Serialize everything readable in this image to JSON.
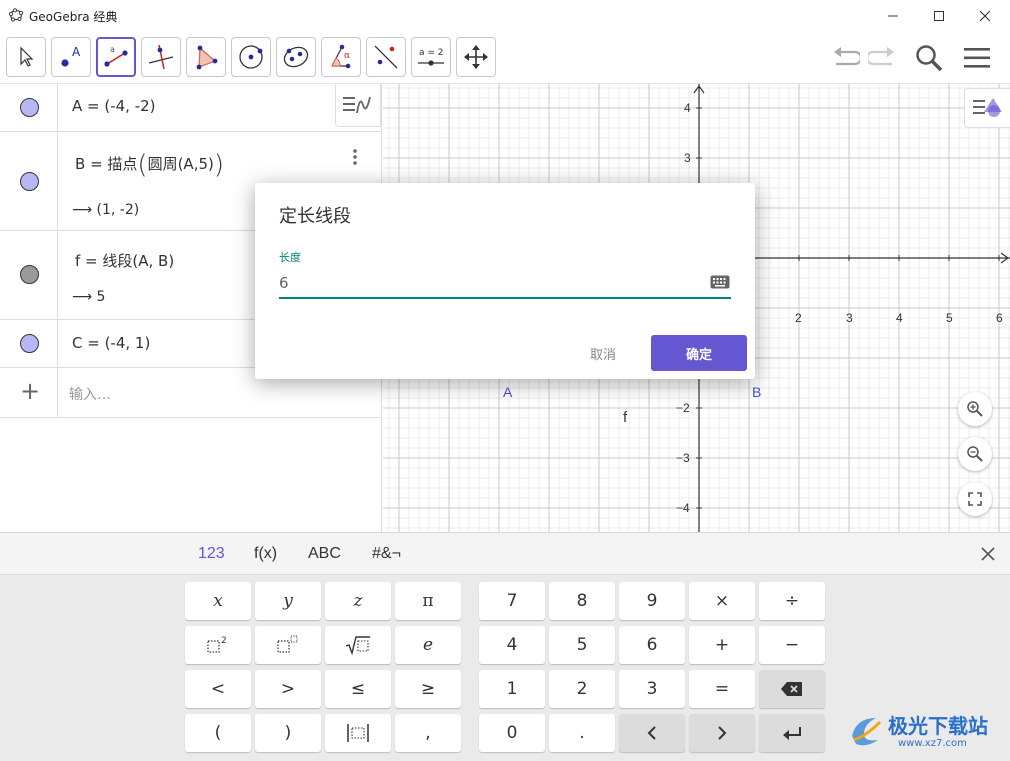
{
  "window": {
    "title": "GeoGebra 经典"
  },
  "toolbar": {
    "tools": [
      {
        "name": "move-tool",
        "icon": "arrow-pointer-icon"
      },
      {
        "name": "point-tool",
        "icon": "point-icon",
        "label": "A"
      },
      {
        "name": "segment-tool",
        "icon": "segment-icon",
        "label": "a",
        "selected": true
      },
      {
        "name": "perpendicular-line-tool",
        "icon": "perpendicular-icon"
      },
      {
        "name": "polygon-tool",
        "icon": "polygon-icon"
      },
      {
        "name": "circle-tool",
        "icon": "circle-icon"
      },
      {
        "name": "ellipse-tool",
        "icon": "ellipse-icon"
      },
      {
        "name": "angle-tool",
        "icon": "angle-icon",
        "label": "α"
      },
      {
        "name": "reflect-tool",
        "icon": "reflect-icon"
      },
      {
        "name": "slider-tool",
        "icon": "slider-icon",
        "label": "a = 2"
      },
      {
        "name": "move-graphics-tool",
        "icon": "move-arrows-icon"
      }
    ]
  },
  "algebra": {
    "rows": [
      {
        "text": "A = (-4, -2)",
        "color": "#b9b6f5"
      },
      {
        "name": "B",
        "cmd": "描点",
        "inner": "圆周(A,5)",
        "result": "⟶ (1, -2)",
        "color": "#b9b6f5"
      },
      {
        "text": "f = 线段(A, B)",
        "result": "⟶ 5",
        "color": "#9a9a9a"
      },
      {
        "text": "C = (-4, 1)",
        "color": "#b9b6f5"
      }
    ],
    "input_placeholder": "输入…",
    "add_symbol": "+"
  },
  "graphics": {
    "x_ticks": [
      "2",
      "3",
      "4",
      "5",
      "6"
    ],
    "y_ticks": [
      "4",
      "3",
      "−2",
      "−3",
      "−4"
    ],
    "point_a_label": "A",
    "point_b_label": "B",
    "segment_label": "f",
    "colors": {
      "point": "#4d4dcc",
      "label": "#4d4dcc"
    }
  },
  "dialog": {
    "title": "定长线段",
    "field_label": "长度",
    "field_value": "6",
    "cancel_label": "取消",
    "ok_label": "确定"
  },
  "keyboard": {
    "tabs": [
      "123",
      "f(x)",
      "ABC",
      "#&¬"
    ],
    "active_tab": "123",
    "left_keys": [
      [
        "x",
        "y",
        "z",
        "π"
      ],
      [
        "□²",
        "□ⁿ",
        "√□",
        "e"
      ],
      [
        "<",
        ">",
        "≤",
        "≥"
      ],
      [
        "(",
        ")",
        "|□|",
        ","
      ]
    ],
    "right_keys": [
      [
        "7",
        "8",
        "9",
        "×",
        "÷"
      ],
      [
        "4",
        "5",
        "6",
        "+",
        "−"
      ],
      [
        "1",
        "2",
        "3",
        "=",
        "⌫"
      ],
      [
        "0",
        ".",
        "<",
        ">",
        "↵"
      ]
    ]
  },
  "watermark": {
    "text": "极光下载站",
    "url": "www.xz7.com"
  }
}
